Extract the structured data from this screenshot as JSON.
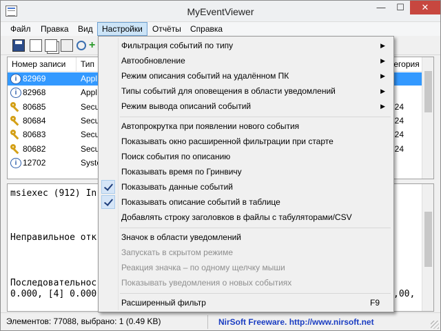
{
  "window": {
    "title": "MyEventViewer"
  },
  "titlebar": {
    "minimize": "—",
    "maximize": "☐",
    "close": "✕"
  },
  "menubar": [
    "Файл",
    "Правка",
    "Вид",
    "Настройки",
    "Отчёты",
    "Справка"
  ],
  "listview": {
    "columns": [
      "Номер записи",
      "Тип",
      "тегория"
    ],
    "rows": [
      {
        "icon": "info-icon",
        "number": "82969",
        "type": "Appl",
        "category": "",
        "selected": true
      },
      {
        "icon": "info-icon",
        "number": "82968",
        "type": "Appl",
        "category": ""
      },
      {
        "icon": "key-icon",
        "number": "80685",
        "type": "Secu",
        "category": "324"
      },
      {
        "icon": "key-icon",
        "number": "80684",
        "type": "Secu",
        "category": "324"
      },
      {
        "icon": "key-icon",
        "number": "80683",
        "type": "Secu",
        "category": "324"
      },
      {
        "icon": "key-icon",
        "number": "80682",
        "type": "Secu",
        "category": "324"
      },
      {
        "icon": "info-icon",
        "number": "12702",
        "type": "Syste",
        "category": ""
      }
    ]
  },
  "details": {
    "lines": [
      "msiexec (912) In",
      "Неправильное отк",
      "Последовательнос",
      "0.000, [4] 0.000"
    ],
    "right_fragment": ",00,"
  },
  "dropdown": {
    "items": [
      {
        "label": "Фильтрация событий по типу",
        "submenu": true
      },
      {
        "label": "Автообновление",
        "submenu": true
      },
      {
        "label": "Режим описания событий на удалённом ПК",
        "submenu": true
      },
      {
        "label": "Типы событий для оповещения в области уведомлений",
        "submenu": true
      },
      {
        "label": "Режим вывода описаний событий",
        "submenu": true
      },
      {
        "separator": true
      },
      {
        "label": "Автопрокрутка при появлении нового события"
      },
      {
        "label": "Показывать окно расширенной фильтрации при старте"
      },
      {
        "label": "Поиск события по описанию"
      },
      {
        "label": "Показывать время по Гринвичу"
      },
      {
        "label": "Показывать данные событий",
        "checked": true
      },
      {
        "label": "Показывать описание событий в таблице",
        "checked": true
      },
      {
        "label": "Добавлять строку заголовков в файлы с табуляторами/CSV"
      },
      {
        "separator": true
      },
      {
        "label": "Значок в области уведомлений"
      },
      {
        "label": "Запускать в скрытом режиме",
        "disabled": true
      },
      {
        "label": "Реакция значка – по одному щелчку мыши",
        "disabled": true
      },
      {
        "label": "Показывать уведомления о новых событиях",
        "disabled": true
      },
      {
        "separator": true
      },
      {
        "label": "Расширенный фильтр",
        "shortcut": "F9"
      }
    ]
  },
  "statusbar": {
    "text": "Элементов: 77088, выбрано: 1  (0.49 KB)",
    "link": "NirSoft Freeware.  http://www.nirsoft.net"
  },
  "colors": {
    "selection": "#3399ff",
    "link": "#1a3dc2",
    "active_menu": "#cce4f7"
  }
}
